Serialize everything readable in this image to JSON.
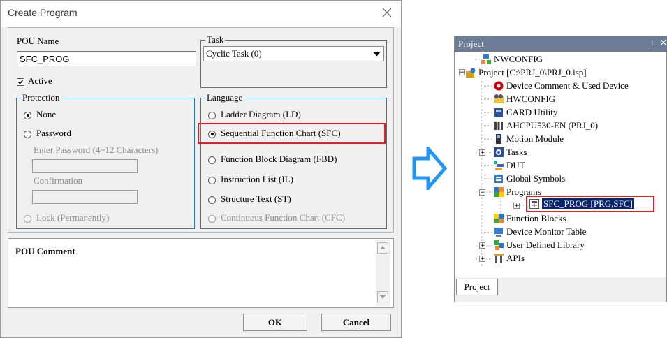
{
  "dialog": {
    "title": "Create Program",
    "pou_name_label": "POU Name",
    "pou_name_value": "SFC_PROG",
    "active_label": "Active",
    "task_label": "Task",
    "task_value": "Cyclic Task (0)",
    "protection": {
      "label": "Protection",
      "none": "None",
      "password": "Password",
      "enter_password": "Enter Password (4~12 Characters)",
      "confirmation": "Confirmation",
      "lock": "Lock (Permanently)"
    },
    "language": {
      "label": "Language",
      "options": [
        "Ladder Diagram (LD)",
        "Sequential Function Chart (SFC)",
        "Function Block Diagram (FBD)",
        "Instruction List (IL)",
        "Structure Text (ST)",
        "Continuous Function Chart (CFC)"
      ],
      "selected_index": 1
    },
    "comment_label": "POU Comment",
    "ok": "OK",
    "cancel": "Cancel"
  },
  "project_panel": {
    "title": "Project",
    "pin_glyph": "⊥",
    "close_glyph": "×",
    "tab": "Project",
    "tree": [
      {
        "label": "NWCONFIG",
        "icon": "network-config-icon"
      },
      {
        "label": "Project [C:\\PRJ_0\\PRJ_0.isp]",
        "icon": "project-icon"
      },
      {
        "label": "Device Comment & Used Device",
        "icon": "device-comment-icon"
      },
      {
        "label": "HWCONFIG",
        "icon": "hardware-config-icon"
      },
      {
        "label": "CARD Utility",
        "icon": "card-utility-icon"
      },
      {
        "label": "AHCPU530-EN  (PRJ_0)",
        "icon": "cpu-icon"
      },
      {
        "label": "Motion Module",
        "icon": "motion-module-icon"
      },
      {
        "label": "Tasks",
        "icon": "tasks-icon"
      },
      {
        "label": "DUT",
        "icon": "dut-icon"
      },
      {
        "label": "Global Symbols",
        "icon": "global-symbols-icon"
      },
      {
        "label": "Programs",
        "icon": "programs-icon"
      },
      {
        "label": "SFC_PROG [PRG,SFC]",
        "icon": "sfc-program-icon"
      },
      {
        "label": "Function Blocks",
        "icon": "function-blocks-icon"
      },
      {
        "label": "Device Monitor Table",
        "icon": "device-monitor-icon"
      },
      {
        "label": "User Defined Library",
        "icon": "user-library-icon"
      },
      {
        "label": "APIs",
        "icon": "apis-icon"
      }
    ]
  },
  "colors": {
    "group_border": "#2d78c8",
    "highlight": "#e02020",
    "panel_header": "#6d7c96",
    "selection": "#0a246a",
    "arrow_fill": "#ffffff",
    "arrow_stroke": "#2196f3"
  }
}
